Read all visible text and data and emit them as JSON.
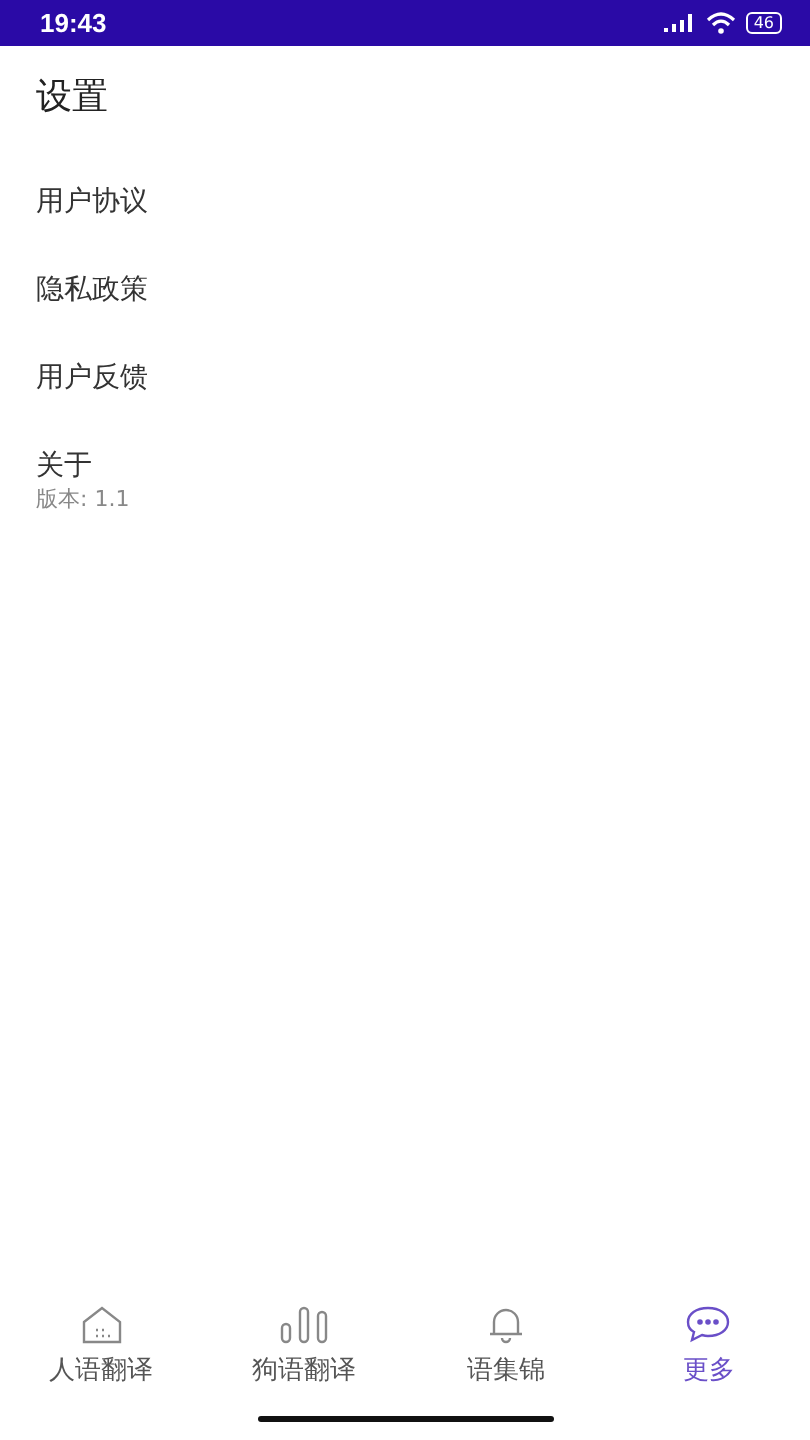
{
  "status_bar": {
    "time": "19:43",
    "battery": "46"
  },
  "title": "设置",
  "items": [
    {
      "label": "用户协议"
    },
    {
      "label": "隐私政策"
    },
    {
      "label": "用户反馈"
    },
    {
      "label": "关于",
      "subtitle": "版本: 1.1"
    }
  ],
  "tabs": [
    {
      "label": "人语翻译",
      "kind": "house",
      "selected": false
    },
    {
      "label": "狗语翻译",
      "kind": "bars",
      "selected": false
    },
    {
      "label": "语集锦",
      "kind": "bell",
      "selected": false
    },
    {
      "label": "更多",
      "kind": "chat",
      "selected": true
    }
  ]
}
